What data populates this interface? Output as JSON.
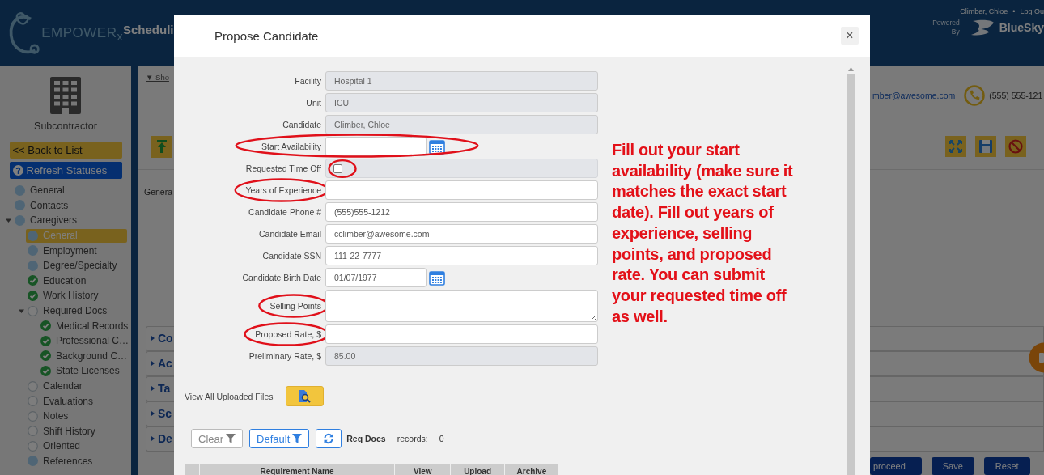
{
  "header": {
    "logo": "EMPOWER$_{x}$",
    "app_title": "Scheduli",
    "user": "Climber, Chloe",
    "separator": "•",
    "logout": "Log Ou",
    "powered": "Powered",
    "by": "By",
    "partner": "BlueSky"
  },
  "sidebar": {
    "title": "Subcontractor",
    "back_button": "<< Back to List",
    "refresh_button": "Refresh Statuses",
    "tree": [
      {
        "label": "General",
        "kind": "filled",
        "selected": false
      },
      {
        "label": "Contacts",
        "kind": "filled",
        "selected": false
      },
      {
        "label": "Caregivers",
        "kind": "filled",
        "selected": false,
        "expanded": true,
        "children": [
          {
            "label": "General",
            "kind": "filled",
            "selected": true
          },
          {
            "label": "Employment",
            "kind": "filled",
            "selected": false
          },
          {
            "label": "Degree/Specialty",
            "kind": "filled",
            "selected": false
          },
          {
            "label": "Education",
            "kind": "done",
            "selected": false
          },
          {
            "label": "Work History",
            "kind": "done",
            "selected": false
          },
          {
            "label": "Required Docs",
            "kind": "empty",
            "selected": false,
            "expanded": true,
            "children": [
              {
                "label": "Medical Records",
                "kind": "done",
                "selected": false
              },
              {
                "label": "Professional C…",
                "kind": "done",
                "selected": false
              },
              {
                "label": "Background C…",
                "kind": "done",
                "selected": false
              },
              {
                "label": "State Licenses",
                "kind": "done",
                "selected": false
              }
            ]
          },
          {
            "label": "Calendar",
            "kind": "empty",
            "selected": false
          },
          {
            "label": "Evaluations",
            "kind": "empty",
            "selected": false
          },
          {
            "label": "Notes",
            "kind": "empty",
            "selected": false
          },
          {
            "label": "Shift History",
            "kind": "empty",
            "selected": false
          },
          {
            "label": "Oriented",
            "kind": "empty",
            "selected": false
          },
          {
            "label": "References",
            "kind": "filled",
            "selected": false
          }
        ]
      }
    ]
  },
  "background": {
    "show_link": "▼ Sho",
    "email": "mber@awesome.com",
    "phone": "(555) 555-121",
    "section_label": "Genera",
    "accordions": [
      "Co",
      "Ac",
      "Ta",
      "Sc",
      "De"
    ],
    "buttons": [
      "proceed",
      "Save",
      "Reset"
    ]
  },
  "modal": {
    "title": "Propose Candidate",
    "close": "×",
    "fields": [
      {
        "label": "Facility",
        "kind": "readonly",
        "value": "Hospital 1",
        "circled": false
      },
      {
        "label": "Unit",
        "kind": "readonly",
        "value": "ICU",
        "circled": false
      },
      {
        "label": "Candidate",
        "kind": "readonly",
        "value": "Climber, Chloe",
        "circled": false
      },
      {
        "label": "Start Availability",
        "kind": "date",
        "circled": true
      },
      {
        "label": "Requested Time Off",
        "kind": "checkbox",
        "checked": false,
        "circled": true
      },
      {
        "label": "Years of Experience",
        "kind": "text",
        "circled": true
      },
      {
        "label": "Candidate Phone #",
        "kind": "text",
        "value": "(555)555-1212",
        "circled": false
      },
      {
        "label": "Candidate Email",
        "kind": "text",
        "value": "cclimber@awesome.com",
        "circled": false
      },
      {
        "label": "Candidate SSN",
        "kind": "text",
        "value": "111-22-7777",
        "circled": false
      },
      {
        "label": "Candidate Birth Date",
        "kind": "date",
        "value": "01/07/1977",
        "circled": false
      },
      {
        "label": "Selling Points",
        "kind": "textarea",
        "circled": true
      },
      {
        "label": "Proposed Rate, $",
        "kind": "text",
        "circled": true
      },
      {
        "label": "Preliminary Rate, $",
        "kind": "readonly",
        "value": "85.00",
        "circled": false
      }
    ],
    "instructions": "Fill out your start availability (make sure it matches the exact start date). Fill out years of experience, selling points, and proposed rate. You can submit your requested time off as well.",
    "files_label": "View All Uploaded Files",
    "toolbar": {
      "clear": "Clear",
      "default": "Default",
      "table_label": "Req Docs",
      "records_label": "records:",
      "records_count": "0"
    },
    "table": {
      "columns": [
        "Requirement Name",
        "View",
        "Upload",
        "Archive"
      ]
    }
  }
}
